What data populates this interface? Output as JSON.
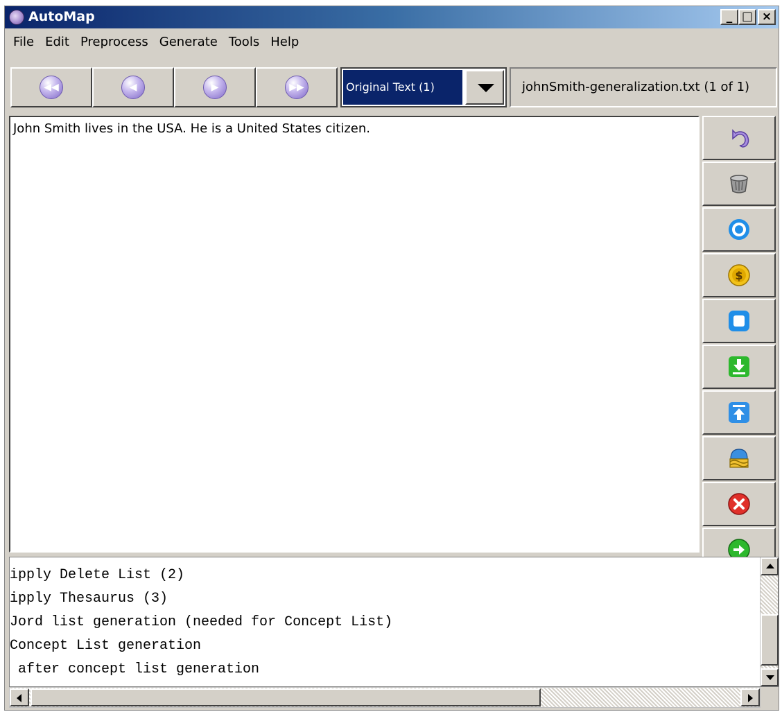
{
  "window": {
    "title": "AutoMap",
    "controls": {
      "minimize": "_",
      "maximize": "□",
      "close": "×"
    }
  },
  "menu": [
    "File",
    "Edit",
    "Preprocess",
    "Generate",
    "Tools",
    "Help"
  ],
  "toolbar": {
    "nav_buttons": [
      {
        "name": "first-icon",
        "glyph": "◀◀"
      },
      {
        "name": "previous-icon",
        "glyph": "◀"
      },
      {
        "name": "next-icon",
        "glyph": "▶"
      },
      {
        "name": "last-icon",
        "glyph": "▶▶"
      }
    ],
    "view_select": {
      "value": "Original Text (1)"
    },
    "file_label": "johnSmith-generalization.txt  (1 of 1)"
  },
  "editor": {
    "text": "John Smith lives in the USA. He is a United States citizen."
  },
  "tools": [
    {
      "name": "undo-icon"
    },
    {
      "name": "delete-list-icon"
    },
    {
      "name": "target-icon"
    },
    {
      "name": "coin-icon"
    },
    {
      "name": "square-icon"
    },
    {
      "name": "download-icon"
    },
    {
      "name": "upload-icon"
    },
    {
      "name": "thesaurus-icon"
    },
    {
      "name": "stop-icon"
    },
    {
      "name": "go-icon"
    }
  ],
  "log": [
    "ipply Delete List (2)",
    "ipply Thesaurus (3)",
    "Jord list generation (needed for Concept List)",
    "Concept List generation",
    " after concept list generation"
  ],
  "colors": {
    "title_start": "#0a246a",
    "title_end": "#a6caf0",
    "face": "#d4d0c8",
    "selection": "#0a246a"
  }
}
